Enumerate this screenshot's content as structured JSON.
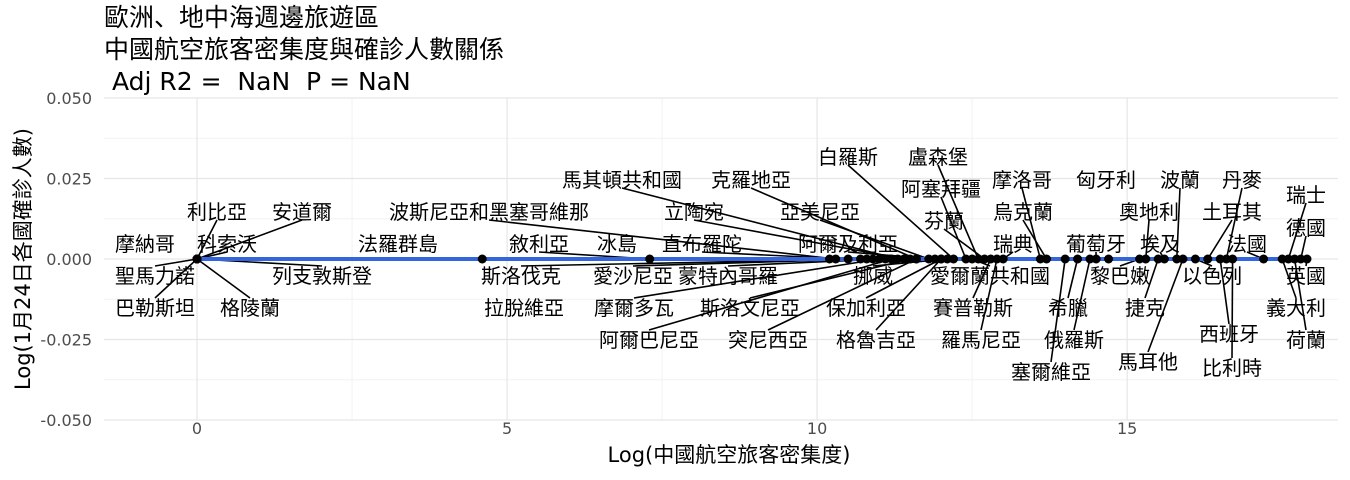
{
  "title": {
    "line1": "歐洲、地中海週邊旅遊區",
    "line2": "中國航空旅客密集度與確診人數關係",
    "line3": " Adj R2 =  NaN  P = NaN"
  },
  "colors": {
    "line": "#3366dd",
    "point": "#000000",
    "grid_major": "#e6e6e6",
    "grid_minor": "#f2f2f2"
  },
  "chart_data": {
    "type": "scatter",
    "title": "歐洲、地中海週邊旅遊區 中國航空旅客密集度與確診人數關係",
    "subtitle": "Adj R2 =  NaN  P = NaN",
    "xlabel": "Log(中國航空旅客密集度)",
    "ylabel": "Log(1月24日各國確診人數)",
    "xlim": [
      -1.5,
      18.4
    ],
    "ylim": [
      -0.05,
      0.05
    ],
    "x_ticks": [
      0,
      5,
      10,
      15
    ],
    "x_tick_labels": [
      "0",
      "5",
      "10",
      "15"
    ],
    "y_ticks": [
      -0.05,
      -0.025,
      0,
      0.025,
      0.05
    ],
    "y_tick_labels": [
      "-0.050",
      "-0.025",
      "0.000",
      "0.025",
      "0.050"
    ],
    "grid": true,
    "fit_line": {
      "x": [
        0,
        17.9
      ],
      "y": [
        0,
        0
      ]
    },
    "points": [
      {
        "label": "摩納哥",
        "x": 0,
        "y": 0
      },
      {
        "label": "利比亞",
        "x": 0,
        "y": 0
      },
      {
        "label": "安道爾",
        "x": 0,
        "y": 0
      },
      {
        "label": "科索沃",
        "x": 0,
        "y": 0
      },
      {
        "label": "聖馬力諾",
        "x": 0,
        "y": 0
      },
      {
        "label": "列支敦斯登",
        "x": 0,
        "y": 0
      },
      {
        "label": "巴勒斯坦",
        "x": 0,
        "y": 0
      },
      {
        "label": "格陵蘭",
        "x": 0,
        "y": 0
      },
      {
        "label": "法羅群島",
        "x": 4.6,
        "y": 0
      },
      {
        "label": "波斯尼亞和黑塞哥維那",
        "x": 10.3,
        "y": 0
      },
      {
        "label": "敘利亞",
        "x": 7.3,
        "y": 0
      },
      {
        "label": "斯洛伐克",
        "x": 10.7,
        "y": 0
      },
      {
        "label": "拉脫維亞",
        "x": 10.9,
        "y": 0
      },
      {
        "label": "冰島",
        "x": 10.2,
        "y": 0
      },
      {
        "label": "愛沙尼亞",
        "x": 10.8,
        "y": 0
      },
      {
        "label": "摩爾多瓦",
        "x": 11.0,
        "y": 0
      },
      {
        "label": "阿爾巴尼亞",
        "x": 11.2,
        "y": 0
      },
      {
        "label": "馬其頓共和國",
        "x": 11.3,
        "y": 0
      },
      {
        "label": "立陶宛",
        "x": 11.4,
        "y": 0
      },
      {
        "label": "直布羅陀",
        "x": 10.5,
        "y": 0
      },
      {
        "label": "蒙特內哥羅",
        "x": 11.1,
        "y": 0
      },
      {
        "label": "斯洛文尼亞",
        "x": 11.5,
        "y": 0
      },
      {
        "label": "突尼西亞",
        "x": 11.6,
        "y": 0
      },
      {
        "label": "克羅地亞",
        "x": 11.6,
        "y": 0
      },
      {
        "label": "亞美尼亞",
        "x": 11.8,
        "y": 0
      },
      {
        "label": "阿爾及利亞",
        "x": 11.9,
        "y": 0
      },
      {
        "label": "保加利亞",
        "x": 12.0,
        "y": 0
      },
      {
        "label": "格魯吉亞",
        "x": 12.0,
        "y": 0
      },
      {
        "label": "白羅斯",
        "x": 12.2,
        "y": 0
      },
      {
        "label": "挪威",
        "x": 12.1,
        "y": 0
      },
      {
        "label": "阿塞拜疆",
        "x": 12.4,
        "y": 0
      },
      {
        "label": "盧森堡",
        "x": 12.6,
        "y": 0
      },
      {
        "label": "芬蘭",
        "x": 12.7,
        "y": 0
      },
      {
        "label": "愛爾蘭共和國",
        "x": 12.5,
        "y": 0
      },
      {
        "label": "賽普勒斯",
        "x": 12.8,
        "y": 0
      },
      {
        "label": "羅馬尼亞",
        "x": 12.9,
        "y": 0
      },
      {
        "label": "瑞典",
        "x": 13.0,
        "y": 0
      },
      {
        "label": "烏克蘭",
        "x": 13.7,
        "y": 0
      },
      {
        "label": "摩洛哥",
        "x": 13.6,
        "y": 0
      },
      {
        "label": "塞爾維亞",
        "x": 14.0,
        "y": 0
      },
      {
        "label": "希臘",
        "x": 14.2,
        "y": 0
      },
      {
        "label": "俄羅斯",
        "x": 14.4,
        "y": 0
      },
      {
        "label": "葡萄牙",
        "x": 14.5,
        "y": 0
      },
      {
        "label": "匈牙利",
        "x": 14.7,
        "y": 0
      },
      {
        "label": "黎巴嫩",
        "x": 15.2,
        "y": 0
      },
      {
        "label": "奧地利",
        "x": 15.3,
        "y": 0
      },
      {
        "label": "捷克",
        "x": 15.5,
        "y": 0
      },
      {
        "label": "埃及",
        "x": 15.6,
        "y": 0
      },
      {
        "label": "波蘭",
        "x": 15.8,
        "y": 0
      },
      {
        "label": "馬耳他",
        "x": 15.9,
        "y": 0
      },
      {
        "label": "以色列",
        "x": 16.1,
        "y": 0
      },
      {
        "label": "土耳其",
        "x": 16.3,
        "y": 0
      },
      {
        "label": "西班牙",
        "x": 16.5,
        "y": 0
      },
      {
        "label": "比利時",
        "x": 16.7,
        "y": 0
      },
      {
        "label": "丹麥",
        "x": 16.6,
        "y": 0
      },
      {
        "label": "法國",
        "x": 17.2,
        "y": 0
      },
      {
        "label": "義大利",
        "x": 17.5,
        "y": 0
      },
      {
        "label": "瑞士",
        "x": 17.6,
        "y": 0
      },
      {
        "label": "荷蘭",
        "x": 17.7,
        "y": 0
      },
      {
        "label": "德國",
        "x": 17.8,
        "y": 0
      },
      {
        "label": "英國",
        "x": 17.9,
        "y": 0
      }
    ]
  }
}
